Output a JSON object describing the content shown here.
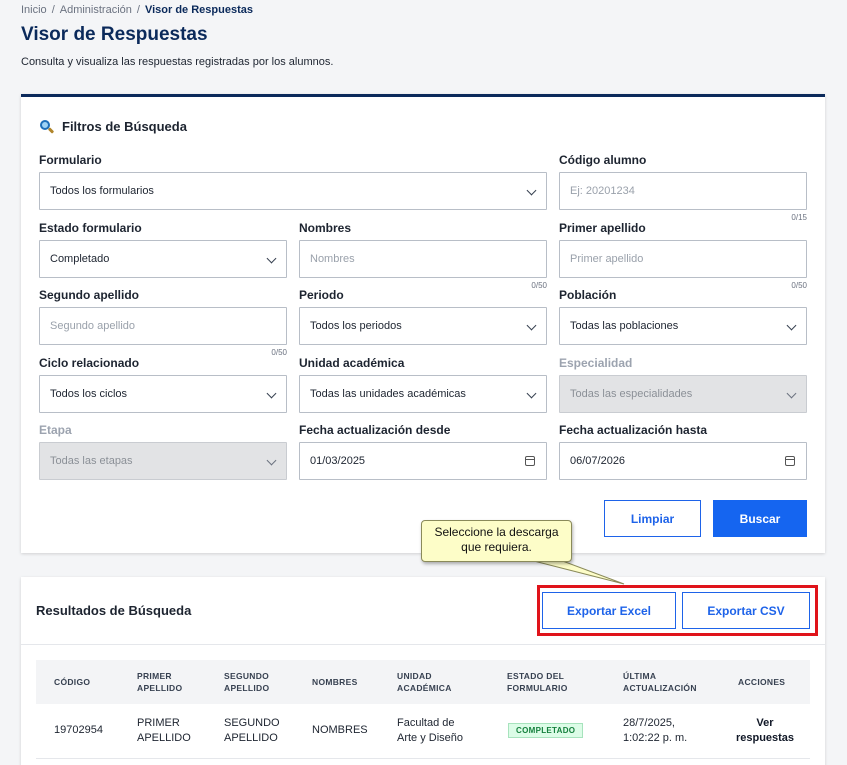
{
  "breadcrumb": {
    "items": [
      "Inicio",
      "Administración"
    ],
    "current": "Visor de Respuestas",
    "separator": "/"
  },
  "page": {
    "title": "Visor de Respuestas",
    "description": "Consulta y visualiza las respuestas registradas por los alumnos."
  },
  "filters": {
    "title": "Filtros de Búsqueda",
    "icon": "magnifier-icon",
    "formulario": {
      "label": "Formulario",
      "value": "Todos los formularios"
    },
    "codigo": {
      "label": "Código alumno",
      "placeholder": "Ej: 20201234",
      "counter": "0/15"
    },
    "estado": {
      "label": "Estado formulario",
      "value": "Completado"
    },
    "nombres": {
      "label": "Nombres",
      "placeholder": "Nombres",
      "counter": "0/50"
    },
    "primer_apellido": {
      "label": "Primer apellido",
      "placeholder": "Primer apellido",
      "counter": "0/50"
    },
    "segundo_apellido": {
      "label": "Segundo apellido",
      "placeholder": "Segundo apellido",
      "counter": "0/50"
    },
    "periodo": {
      "label": "Periodo",
      "value": "Todos los periodos"
    },
    "poblacion": {
      "label": "Población",
      "value": "Todas las poblaciones"
    },
    "ciclo": {
      "label": "Ciclo relacionado",
      "value": "Todos los ciclos"
    },
    "unidad": {
      "label": "Unidad académica",
      "value": "Todas las unidades académicas"
    },
    "especialidad": {
      "label": "Especialidad",
      "value": "Todas las especialidades"
    },
    "etapa": {
      "label": "Etapa",
      "value": "Todas las etapas"
    },
    "fecha_desde": {
      "label": "Fecha actualización desde",
      "value": "01/03/2025"
    },
    "fecha_hasta": {
      "label": "Fecha actualización hasta",
      "value": "06/07/2026"
    },
    "clear_label": "Limpiar",
    "search_label": "Buscar"
  },
  "tooltip": {
    "line1": "Seleccione la descarga",
    "line2": "que requiera."
  },
  "results": {
    "title": "Resultados de Búsqueda",
    "export_excel": "Exportar Excel",
    "export_csv": "Exportar CSV",
    "columns": {
      "codigo": "CÓDIGO",
      "primer_1": "PRIMER",
      "primer_2": "APELLIDO",
      "segundo_1": "SEGUNDO",
      "segundo_2": "APELLIDO",
      "nombres": "NOMBRES",
      "unidad_1": "UNIDAD",
      "unidad_2": "ACADÉMICA",
      "estado_1": "ESTADO DEL",
      "estado_2": "FORMULARIO",
      "ultima_1": "ÚLTIMA",
      "ultima_2": "ACTUALIZACIÓN",
      "acciones": "ACCIONES"
    },
    "rows": [
      {
        "codigo": "19702954",
        "primer_1": "PRIMER",
        "primer_2": "APELLIDO",
        "segundo_1": "SEGUNDO",
        "segundo_2": "APELLIDO",
        "nombres": "NOMBRES",
        "unidad_1": "Facultad de",
        "unidad_2": "Arte y Diseño",
        "estado": "COMPLETADO",
        "fecha_1": "28/7/2025,",
        "fecha_2": "1:02:22 p. m.",
        "accion_1": "Ver",
        "accion_2": "respuestas"
      }
    ]
  },
  "colors": {
    "brand": "#0b2a5b",
    "primary": "#1565f0",
    "highlight": "#e0131a",
    "success": "#15803d"
  }
}
